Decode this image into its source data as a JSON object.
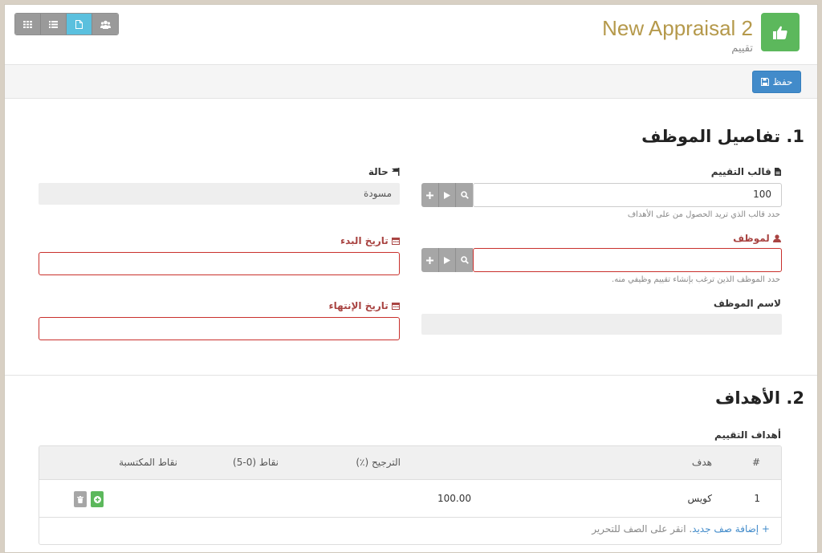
{
  "header": {
    "title": "New Appraisal 2",
    "subtitle": "تقييم",
    "icon": "thumbs-up-icon",
    "view_buttons": [
      {
        "icon": "grid-icon",
        "active": false
      },
      {
        "icon": "list-icon",
        "active": false
      },
      {
        "icon": "document-icon",
        "active": true
      },
      {
        "icon": "users-icon",
        "active": false
      }
    ]
  },
  "toolbar": {
    "save_label": "حفظ",
    "save_icon": "floppy-icon"
  },
  "section1": {
    "title": "1. تفاصيل الموظف",
    "template": {
      "label": "قالب التقييم",
      "icon": "file-icon",
      "value": "100",
      "help": "حدد قالب الذي تريد الحصول من على الأهداف"
    },
    "status": {
      "label": "حالة",
      "icon": "flag-icon",
      "value": "مسودة"
    },
    "employee": {
      "label": "لموظف",
      "icon": "user-icon",
      "value": "",
      "help": "حدد الموظف الذين ترغب بإنشاء تقييم وظيفي منه."
    },
    "start_date": {
      "label": "تاريخ البدء",
      "icon": "calendar-icon",
      "value": ""
    },
    "employee_name": {
      "label": "لاسم الموظف",
      "value": ""
    },
    "end_date": {
      "label": "تاريخ الإنتهاء",
      "icon": "calendar-icon",
      "value": ""
    }
  },
  "section2": {
    "title": "2. الأهداف",
    "table_label": "أهداف التقييم",
    "columns": [
      "#",
      "هدف",
      "الترجيح (٪)",
      "نقاط (0-5)",
      "نقاط المكتسبة"
    ],
    "rows": [
      {
        "idx": "1",
        "goal": "كويس",
        "weight": "100.00",
        "score": "",
        "earned": ""
      }
    ],
    "add_row_link": "+ إضافة صف جديد",
    "add_row_hint": ". انقر على الصف للتحرير"
  },
  "colors": {
    "accent": "#428bca",
    "title": "#b5994b",
    "success": "#5cb85c",
    "danger": "#a94442",
    "info": "#5bc0de"
  }
}
